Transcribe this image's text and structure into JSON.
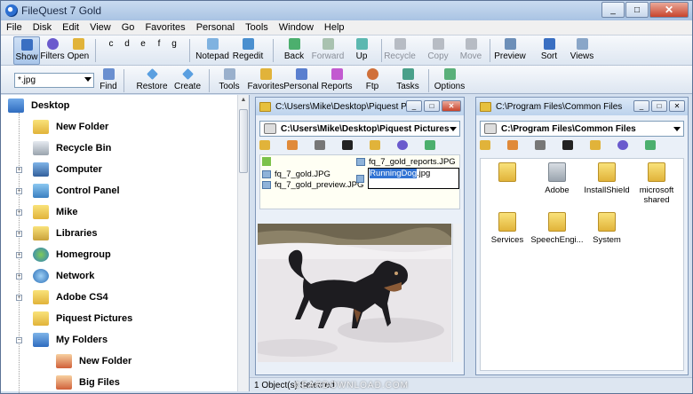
{
  "window": {
    "title": "FileQuest 7 Gold",
    "min": "_",
    "max": "□",
    "close": "✕"
  },
  "menu": [
    "File",
    "Disk",
    "Edit",
    "View",
    "Go",
    "Favorites",
    "Personal",
    "Tools",
    "Window",
    "Help"
  ],
  "toolbar1": {
    "show": "Show",
    "filters": "Filters",
    "open": "Open",
    "drives": [
      "c",
      "d",
      "e",
      "f",
      "g"
    ],
    "notepad": "Notepad",
    "regedit": "Regedit",
    "back": "Back",
    "forward": "Forward",
    "up": "Up",
    "recycle": "Recycle",
    "copy": "Copy",
    "move": "Move",
    "preview": "Preview",
    "sort": "Sort",
    "views": "Views"
  },
  "toolbar2": {
    "filter_value": "*.jpg",
    "find": "Find",
    "restore": "Restore",
    "create": "Create",
    "tools": "Tools",
    "favorites": "Favorites",
    "personal": "Personal",
    "reports": "Reports",
    "ftp": "Ftp",
    "tasks": "Tasks",
    "options": "Options"
  },
  "tree": {
    "root": "Desktop",
    "items": [
      "New Folder",
      "Recycle Bin",
      "Computer",
      "Control Panel",
      "Mike",
      "Libraries",
      "Homegroup",
      "Network",
      "Adobe CS4",
      "Piquest Pictures",
      "My Folders"
    ],
    "subitems": [
      "New Folder",
      "Big Files"
    ]
  },
  "left_pane": {
    "title": "C:\\Users\\Mike\\Desktop\\Piquest P...",
    "path": "C:\\Users\\Mike\\Desktop\\Piquest Pictures",
    "files": [
      "fq_7_gold.JPG",
      "fq_7_gold_preview.JPG",
      "fq_7_gold_reports.JPG"
    ],
    "renaming": {
      "selected": "RunningDog",
      "ext": ".jpg"
    }
  },
  "right_pane": {
    "title": "C:\\Program Files\\Common Files",
    "path": "C:\\Program Files\\Common Files",
    "folders": [
      "Adobe",
      "InstallShield",
      "microsoft shared",
      "Services",
      "SpeechEngi...",
      "System"
    ]
  },
  "status": "1 Object(s) Selected",
  "watermark": "©EARDOWNLOAD.COM",
  "colors": {
    "selection": "#3173d3",
    "folder": "#e1b33a"
  }
}
